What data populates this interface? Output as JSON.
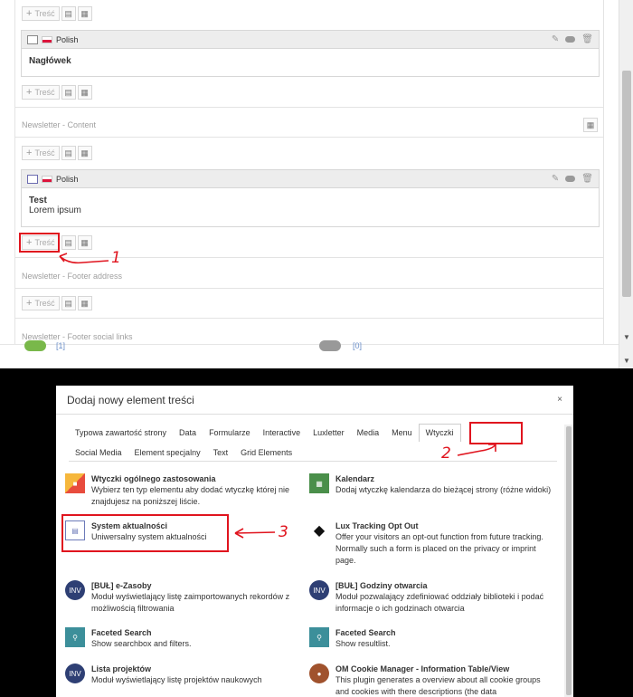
{
  "backend": {
    "new_content_label": "Treść",
    "top_element": {
      "language": "Polish",
      "heading": "Nagłówek"
    },
    "column_content_label": "Newsletter - Content",
    "content_element": {
      "language": "Polish",
      "heading": "Test",
      "body": "Lorem ipsum"
    },
    "column_footer_address_label": "Newsletter - Footer address",
    "column_footer_social_label": "Newsletter - Footer social links",
    "partial_link_left": "[1]",
    "partial_link_right": "[0]"
  },
  "modal": {
    "title": "Dodaj nowy element treści",
    "close_glyph": "×",
    "tabs_row1": [
      "Typowa zawartość strony",
      "Data",
      "Formularze",
      "Interactive",
      "Luxletter",
      "Media",
      "Menu",
      "Wtyczki"
    ],
    "tabs_row2": [
      "Social Media",
      "Element specjalny",
      "Text",
      "Grid Elements"
    ],
    "active_tab": "Wtyczki",
    "items": [
      {
        "title": "Wtyczki ogólnego zastosowania",
        "desc": "Wybierz ten typ elementu aby dodać wtyczkę której nie znajdujesz na poniższej liście.",
        "icon": "cube-icon",
        "color": "#f6b73c"
      },
      {
        "title": "Kalendarz",
        "desc": "Dodaj wtyczkę kalendarza do bieżącej strony (różne widoki)",
        "icon": "calendar-icon",
        "color": "#4a8f4a"
      },
      {
        "title": "System aktualności",
        "desc": "Uniwersalny system aktualności",
        "icon": "news-icon",
        "color": "#6c7ab8"
      },
      {
        "title": "Lux Tracking Opt Out",
        "desc": "Offer your visitors an opt-out function from future tracking. Normally such a form is placed on the privacy or imprint page.",
        "icon": "lux-cat-icon",
        "color": "#111111"
      },
      {
        "title": "[BUŁ] e-Zasoby",
        "desc": "Moduł wyświetlający listę zaimportowanych rekordów z możliwością filtrowania",
        "icon": "inv-icon",
        "color": "#2e3f74"
      },
      {
        "title": "[BUŁ] Godziny otwarcia",
        "desc": "Moduł pozwalający zdefiniować oddziały biblioteki i podać informacje o ich godzinach otwarcia",
        "icon": "inv-icon",
        "color": "#2e3f74"
      },
      {
        "title": "Faceted Search",
        "desc": "Show searchbox and filters.",
        "icon": "faceted-search-icon",
        "color": "#3c8f9a"
      },
      {
        "title": "Faceted Search",
        "desc": "Show resultlist.",
        "icon": "faceted-search-icon",
        "color": "#3c8f9a"
      },
      {
        "title": "Lista projektów",
        "desc": "Moduł wyświetlający listę projektów naukowych",
        "icon": "inv-icon",
        "color": "#2e3f74"
      },
      {
        "title": "OM Cookie Manager - Information Table/View",
        "desc": "This plugin generates a overview about all cookie groups and cookies with there descriptions (the data",
        "icon": "cookie-icon",
        "color": "#a0522d"
      }
    ],
    "inv_text": "INV"
  },
  "annotations": {
    "step1": "1",
    "step2": "2",
    "step3": "3",
    "color": "#e0141e"
  }
}
